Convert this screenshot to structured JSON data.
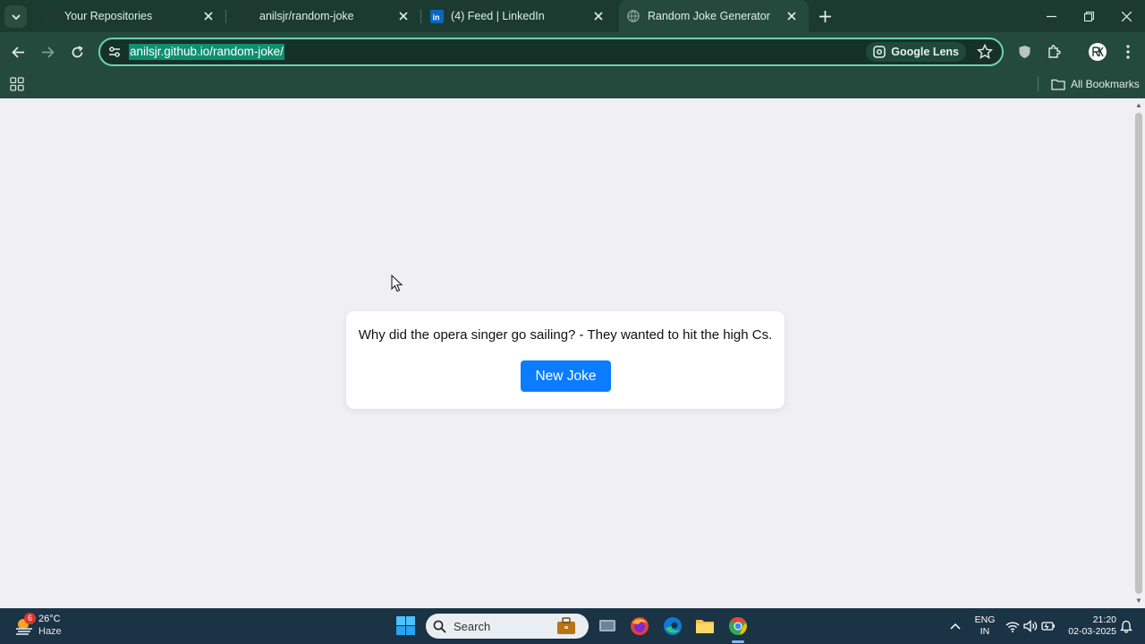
{
  "browser": {
    "tabs": [
      {
        "title": "Your Repositories",
        "active": false
      },
      {
        "title": "anilsjr/random-joke",
        "active": false
      },
      {
        "title": "(4) Feed | LinkedIn",
        "active": false
      },
      {
        "title": "Random Joke Generator",
        "active": true
      }
    ],
    "url": "anilsjr.github.io/random-joke/",
    "lens_label": "Google Lens",
    "all_bookmarks_label": "All Bookmarks"
  },
  "page": {
    "joke": "Why did the opera singer go sailing? - They wanted to hit the high Cs.",
    "button_label": "New Joke"
  },
  "taskbar": {
    "weather": {
      "badge": "6",
      "temp": "26°C",
      "condition": "Haze"
    },
    "search_label": "Search",
    "language": {
      "line1": "ENG",
      "line2": "IN"
    },
    "clock": {
      "time": "21:20",
      "date": "02-03-2025"
    }
  },
  "colors": {
    "chrome_dark": "#1b3b30",
    "chrome_toolbar": "#244a3d",
    "omnibox_border": "#6fd1b4",
    "button_blue": "#0b7cff",
    "taskbar": "#1a3345"
  }
}
